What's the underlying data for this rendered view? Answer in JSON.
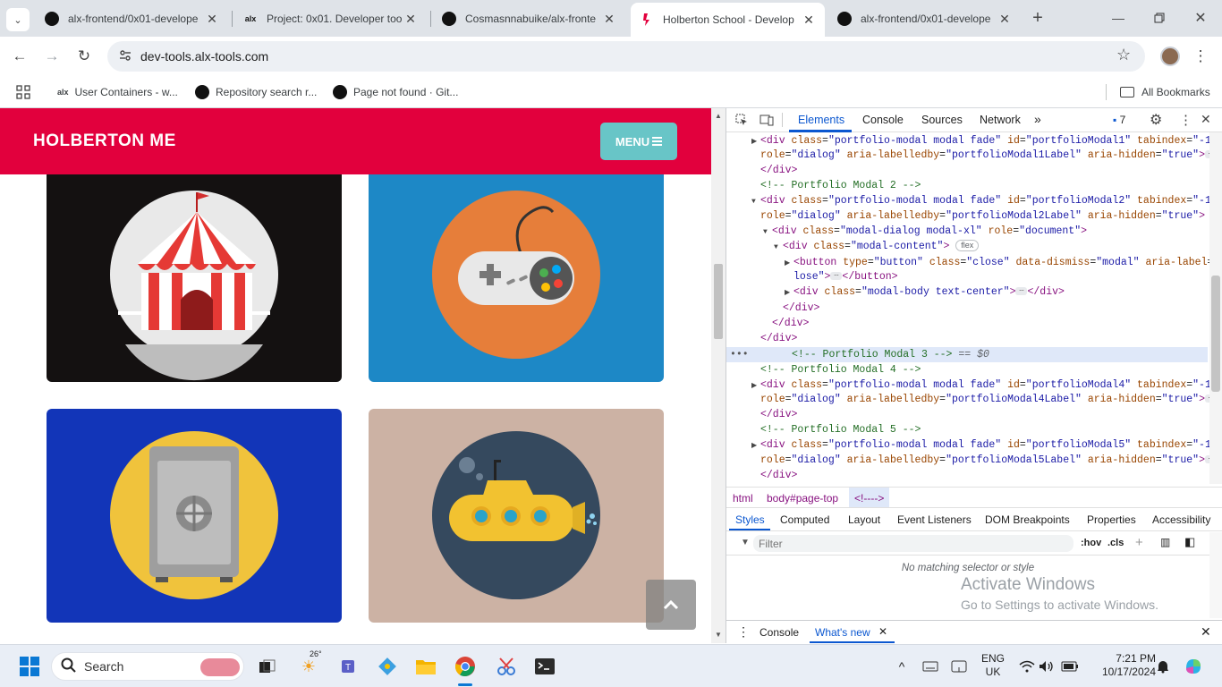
{
  "browser": {
    "tabs": [
      {
        "title": "alx-frontend/0x01-develope",
        "favicon": "github-icon"
      },
      {
        "title": "Project: 0x01. Developer too",
        "favicon": "alx-icon"
      },
      {
        "title": "Cosmasnnabuike/alx-fronte",
        "favicon": "github-icon"
      },
      {
        "title": "Holberton School - Develop",
        "favicon": "holberton-icon",
        "active": true
      },
      {
        "title": "alx-frontend/0x01-develope",
        "favicon": "github-icon"
      }
    ],
    "url": "dev-tools.alx-tools.com",
    "bookmarks": [
      {
        "label": "User Containers - w..."
      },
      {
        "label": "Repository search r..."
      },
      {
        "label": "Page not found · Git..."
      }
    ],
    "all_bookmarks_label": "All Bookmarks"
  },
  "site": {
    "brand": "HOLBERTON ME",
    "menu_label": "MENU",
    "colors": {
      "navbar": "#e2003d",
      "menu": "#68c5c7"
    },
    "portfolio": [
      {
        "name": "circus-tent",
        "bg": "#141111"
      },
      {
        "name": "game-controller",
        "bg": "#1d88c6"
      },
      {
        "name": "safe",
        "bg": "#1235b8"
      },
      {
        "name": "submarine",
        "bg": "#ccb2a4"
      }
    ]
  },
  "devtools": {
    "tabs": [
      "Elements",
      "Console",
      "Sources",
      "Network"
    ],
    "active_tab": "Elements",
    "issues_count": "7",
    "breadcrumbs": [
      "html",
      "body#page-top",
      "<!---->"
    ],
    "style_tabs": [
      "Styles",
      "Computed",
      "Layout",
      "Event Listeners",
      "DOM Breakpoints",
      "Properties",
      "Accessibility"
    ],
    "filter_placeholder": "Filter",
    "hov": ":hov",
    "cls": ".cls",
    "no_match": "No matching selector or style",
    "drawer_tabs": [
      "Console",
      "What's new"
    ],
    "selected_suffix": "== $0"
  },
  "activation": {
    "title": "Activate Windows",
    "subtitle": "Go to Settings to activate Windows."
  },
  "taskbar": {
    "search_label": "Search",
    "weather": "26°",
    "lang": "ENG",
    "region": "UK",
    "time": "7:21 PM",
    "date": "10/17/2024"
  }
}
